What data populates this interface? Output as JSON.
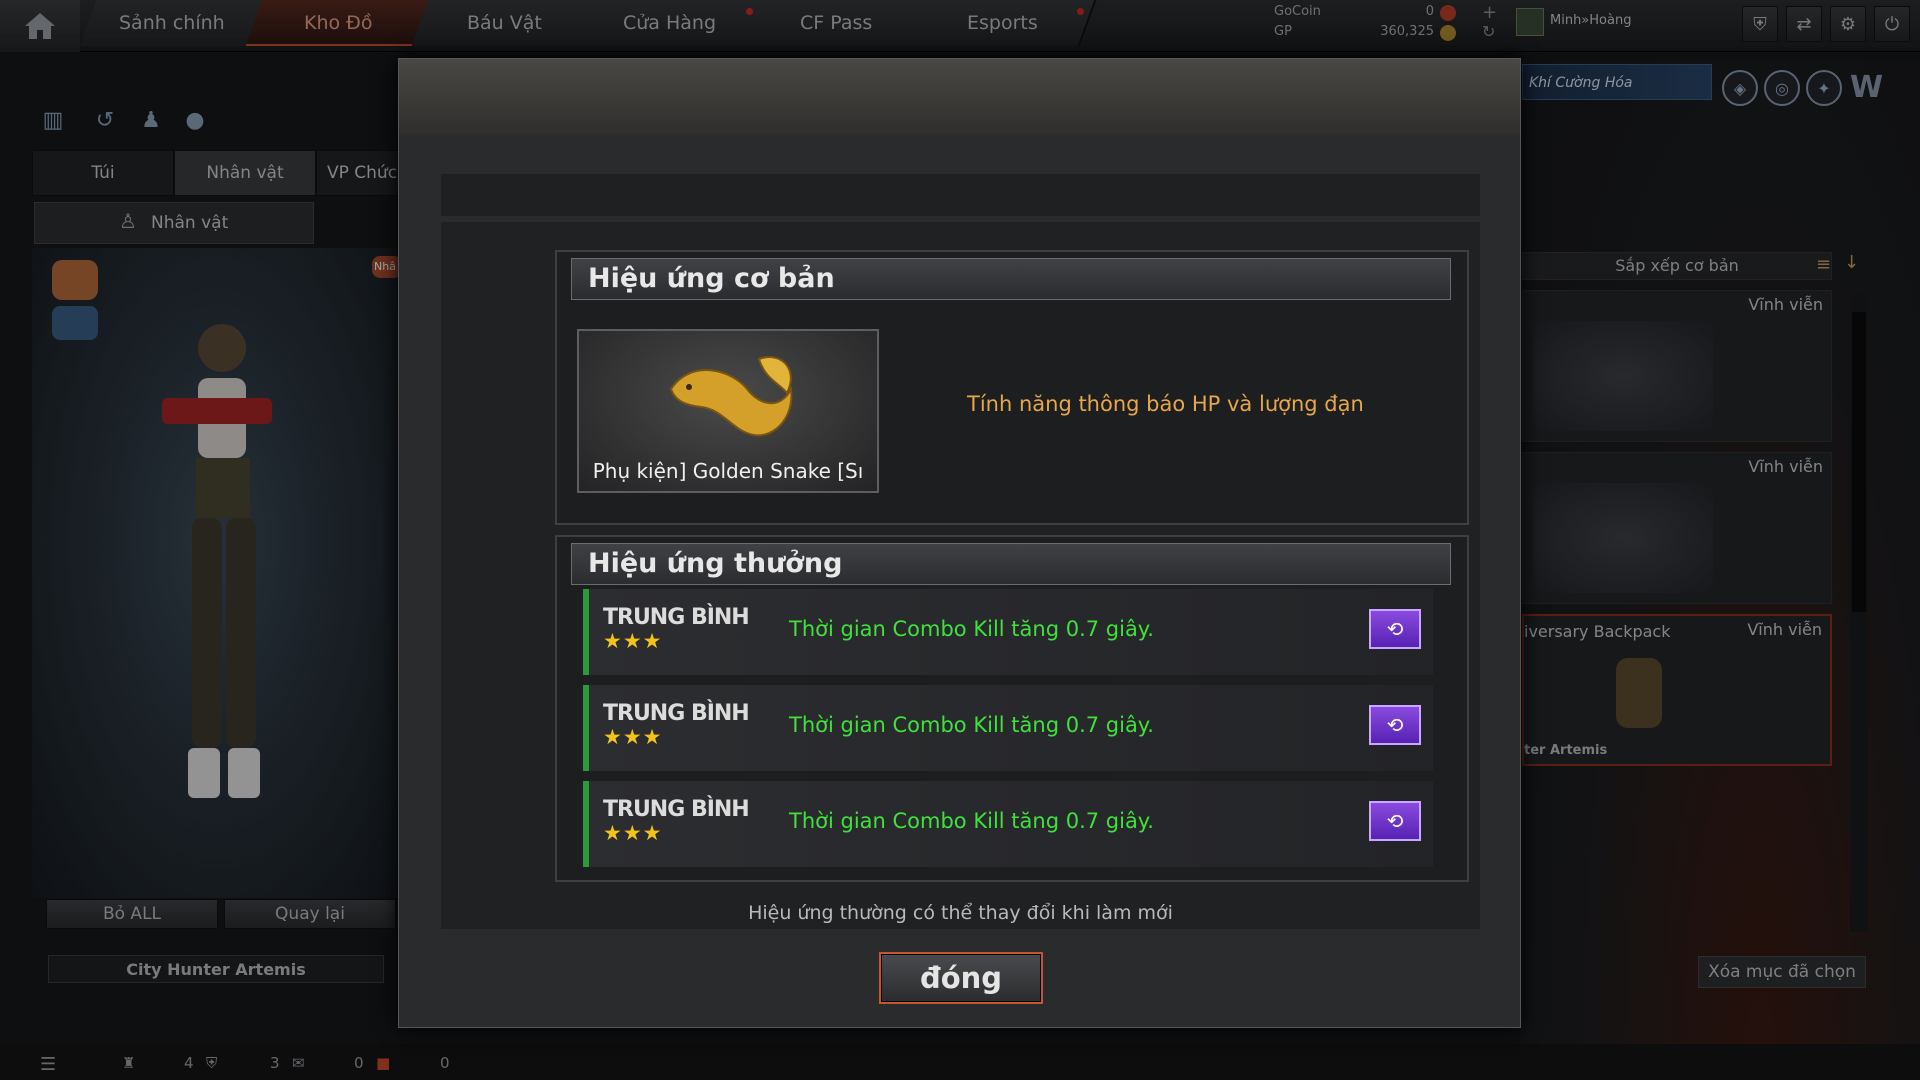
{
  "top_nav": {
    "tabs": [
      "Sảnh chính",
      "Kho Đồ",
      "Báu Vật",
      "Cửa Hàng",
      "CF Pass",
      "Esports"
    ],
    "active_tab": "Kho Đồ",
    "gocoin_label": "GoCoin",
    "gocoin_value": "0",
    "gp_label": "GP",
    "gp_value": "360,325",
    "username": "Minh»Hoàng"
  },
  "left_panel": {
    "tabs": [
      "Túi",
      "Nhân vật",
      "VP Chức"
    ],
    "sub_tab": "Nhân vật",
    "badge": "Nhâ",
    "buttons": [
      "Bỏ ALL",
      "Quay lại"
    ],
    "character_name": "City Hunter Artemis"
  },
  "right_panel": {
    "weapon_banner": "Khí Cường Hóa",
    "sort_label": "Sắp xếp cơ bản",
    "items": [
      {
        "duration": "Vĩnh viễn",
        "name": "",
        "owner": ""
      },
      {
        "duration": "Vĩnh viễn",
        "name": "",
        "owner": ""
      },
      {
        "duration": "Vĩnh viễn",
        "name": "iversary Backpack",
        "owner": "ter Artemis"
      }
    ],
    "clear_button": "Xóa mục đã chọn"
  },
  "status_bar": {
    "counts": [
      "4",
      "3",
      "0",
      "0"
    ]
  },
  "modal": {
    "basic_effect_title": "Hiệu ứng cơ bản",
    "item_label": "Phụ kiện] Golden Snake [Sı",
    "item_description": "Tính năng thông báo HP và lượng đạn",
    "bonus_effect_title": "Hiệu ứng thưởng",
    "bonus_rows": [
      {
        "tier": "TRUNG BÌNH",
        "stars": "★★★",
        "text": "Thời gian Combo Kill tăng 0.7 giây."
      },
      {
        "tier": "TRUNG BÌNH",
        "stars": "★★★",
        "text": "Thời gian Combo Kill tăng 0.7 giây."
      },
      {
        "tier": "TRUNG BÌNH",
        "stars": "★★★",
        "text": "Thời gian Combo Kill tăng 0.7 giây."
      }
    ],
    "note": "Hiệu ứng thường có thể thay đổi khi làm mới",
    "close_button": "đóng"
  }
}
